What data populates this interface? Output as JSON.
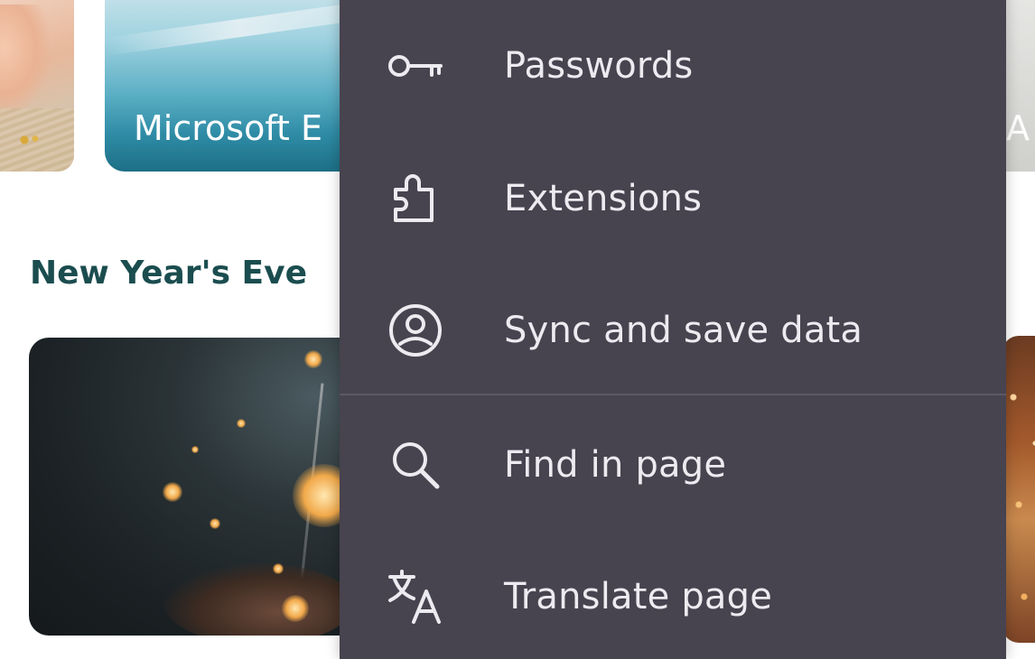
{
  "background": {
    "cards": [
      {
        "name": "card-left",
        "label": ""
      },
      {
        "name": "card-microsoft-edge",
        "label": "Microsoft E"
      },
      {
        "name": "card-right",
        "label": "A"
      }
    ],
    "section_heading": "New Year's Eve"
  },
  "menu": {
    "items": [
      {
        "label": "Passwords",
        "icon": "key-icon"
      },
      {
        "label": "Extensions",
        "icon": "puzzle-icon"
      },
      {
        "label": "Sync and save data",
        "icon": "account-circle-icon"
      },
      {
        "label": "Find in page",
        "icon": "search-icon"
      },
      {
        "label": "Translate page",
        "icon": "translate-icon"
      }
    ]
  },
  "colors": {
    "menu_background": "#47434f",
    "menu_text": "#ecebf0",
    "heading": "#1b4d4f"
  }
}
